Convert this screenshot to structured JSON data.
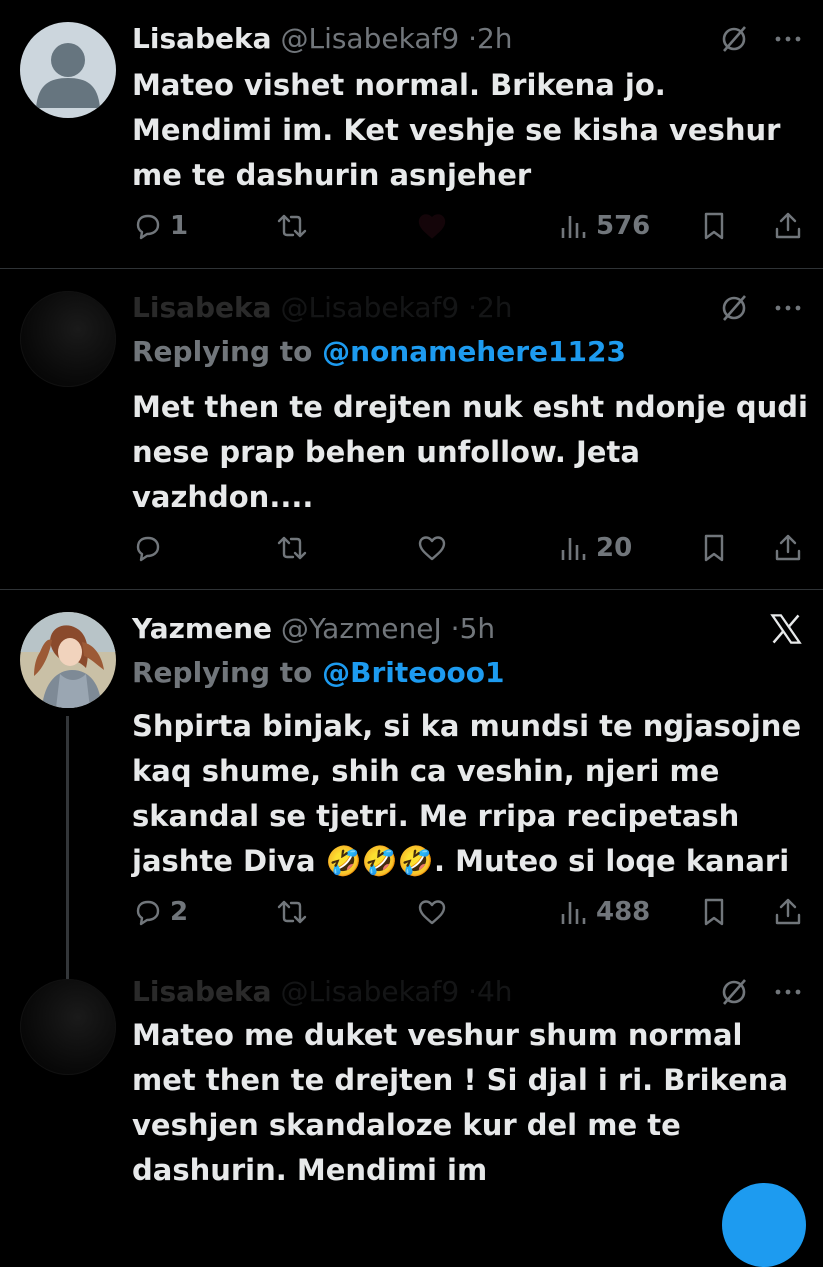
{
  "tweets": [
    {
      "name": "Lisabeka",
      "handle": "@Lisabekaf9",
      "time": "2h",
      "text_lines": [
        "Mateo vishet normal. Brikena jo.",
        "Mendimi im. Ket veshje se kisha veshur",
        "me te dashurin asnjeher"
      ],
      "reply_count": "1",
      "views": "576"
    },
    {
      "name": "Lisabeka",
      "handle": "@Lisabekaf9",
      "time": "2h",
      "replying_prefix": "Replying to",
      "replying_to": "@nonamehere1123",
      "text_lines": [
        "Met then te drejten nuk esht ndonje qudi",
        "nese prap behen unfollow. Jeta",
        "vazhdon...."
      ],
      "views": "20"
    },
    {
      "name": "Yazmene",
      "handle": "@YazmeneJ",
      "time": "5h",
      "replying_prefix": "Replying to",
      "replying_to": "@Briteooo1",
      "text_lines": [
        "Shpirta binjak, si ka mundsi te ngjasojne",
        "kaq shume, shih ca veshin, njeri me",
        "skandal se tjetri. Me rripa recipetash"
      ],
      "text_last_before": "jashte Diva ",
      "emoji": "🤣🤣🤣",
      "text_last_after": ". Muteo si loqe kanari",
      "reply_count": "2",
      "views": "488"
    },
    {
      "name": "Lisabeka",
      "handle": "@Lisabekaf9",
      "time": "4h",
      "text_lines": [
        "Mateo me duket veshur shum normal",
        "met then te drejten ! Si djal i ri. Brikena",
        "veshjen skandaloze kur del me te",
        "dashurin. Mendimi im"
      ]
    }
  ],
  "separator": "·",
  "more_glyph": "···",
  "colors": {
    "background": "#000000",
    "text": "#e7e9ea",
    "muted": "#71767b",
    "link": "#1d9bf0",
    "divider": "#2f3336"
  },
  "icons": [
    "reply-icon",
    "retweet-icon",
    "like-icon",
    "views-icon",
    "bookmark-icon",
    "share-icon",
    "hidden-eye-icon",
    "more-icon",
    "x-logo-icon"
  ]
}
